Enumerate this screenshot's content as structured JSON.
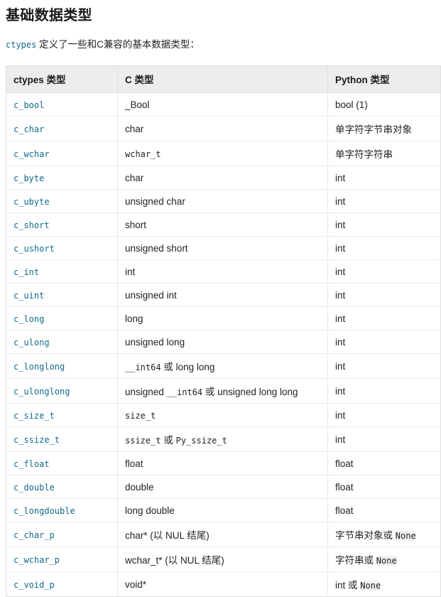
{
  "document": {
    "title": "基础数据类型",
    "intro": {
      "code": "ctypes",
      "text": " 定义了一些和C兼容的基本数据类型："
    }
  },
  "table": {
    "headers": {
      "ctypes": "ctypes 类型",
      "c": "C 类型",
      "python": "Python 类型"
    },
    "rows": [
      {
        "ctypes": "c_bool",
        "c_parts": [
          {
            "t": "_Bool",
            "style": "sans"
          }
        ],
        "py_parts": [
          {
            "t": "bool (1)",
            "style": "sans"
          }
        ]
      },
      {
        "ctypes": "c_char",
        "c_parts": [
          {
            "t": "char",
            "style": "sans"
          }
        ],
        "py_parts": [
          {
            "t": "单字符字节串对象",
            "style": "sans"
          }
        ]
      },
      {
        "ctypes": "c_wchar",
        "c_parts": [
          {
            "t": "wchar_t",
            "style": "mono"
          }
        ],
        "py_parts": [
          {
            "t": "单字符字符串",
            "style": "sans"
          }
        ]
      },
      {
        "ctypes": "c_byte",
        "c_parts": [
          {
            "t": "char",
            "style": "sans"
          }
        ],
        "py_parts": [
          {
            "t": "int",
            "style": "sans"
          }
        ]
      },
      {
        "ctypes": "c_ubyte",
        "c_parts": [
          {
            "t": "unsigned char",
            "style": "sans"
          }
        ],
        "py_parts": [
          {
            "t": "int",
            "style": "sans"
          }
        ]
      },
      {
        "ctypes": "c_short",
        "c_parts": [
          {
            "t": "short",
            "style": "sans"
          }
        ],
        "py_parts": [
          {
            "t": "int",
            "style": "sans"
          }
        ]
      },
      {
        "ctypes": "c_ushort",
        "c_parts": [
          {
            "t": "unsigned short",
            "style": "sans"
          }
        ],
        "py_parts": [
          {
            "t": "int",
            "style": "sans"
          }
        ]
      },
      {
        "ctypes": "c_int",
        "c_parts": [
          {
            "t": "int",
            "style": "sans"
          }
        ],
        "py_parts": [
          {
            "t": "int",
            "style": "sans"
          }
        ]
      },
      {
        "ctypes": "c_uint",
        "c_parts": [
          {
            "t": "unsigned int",
            "style": "sans"
          }
        ],
        "py_parts": [
          {
            "t": "int",
            "style": "sans"
          }
        ]
      },
      {
        "ctypes": "c_long",
        "c_parts": [
          {
            "t": "long",
            "style": "sans"
          }
        ],
        "py_parts": [
          {
            "t": "int",
            "style": "sans"
          }
        ]
      },
      {
        "ctypes": "c_ulong",
        "c_parts": [
          {
            "t": "unsigned long",
            "style": "sans"
          }
        ],
        "py_parts": [
          {
            "t": "int",
            "style": "sans"
          }
        ]
      },
      {
        "ctypes": "c_longlong",
        "c_parts": [
          {
            "t": "__int64",
            "style": "mono"
          },
          {
            "t": " 或 long long",
            "style": "sans"
          }
        ],
        "py_parts": [
          {
            "t": "int",
            "style": "sans"
          }
        ]
      },
      {
        "ctypes": "c_ulonglong",
        "c_parts": [
          {
            "t": "unsigned ",
            "style": "sans"
          },
          {
            "t": "__int64",
            "style": "mono"
          },
          {
            "t": " 或 unsigned long long",
            "style": "sans"
          }
        ],
        "py_parts": [
          {
            "t": "int",
            "style": "sans"
          }
        ]
      },
      {
        "ctypes": "c_size_t",
        "c_parts": [
          {
            "t": "size_t",
            "style": "mono"
          }
        ],
        "py_parts": [
          {
            "t": "int",
            "style": "sans"
          }
        ]
      },
      {
        "ctypes": "c_ssize_t",
        "c_parts": [
          {
            "t": "ssize_t",
            "style": "mono"
          },
          {
            "t": " 或 ",
            "style": "sans"
          },
          {
            "t": "Py_ssize_t",
            "style": "mono"
          }
        ],
        "py_parts": [
          {
            "t": "int",
            "style": "sans"
          }
        ]
      },
      {
        "ctypes": "c_float",
        "c_parts": [
          {
            "t": "float",
            "style": "sans"
          }
        ],
        "py_parts": [
          {
            "t": "float",
            "style": "sans"
          }
        ]
      },
      {
        "ctypes": "c_double",
        "c_parts": [
          {
            "t": "double",
            "style": "sans"
          }
        ],
        "py_parts": [
          {
            "t": "float",
            "style": "sans"
          }
        ]
      },
      {
        "ctypes": "c_longdouble",
        "c_parts": [
          {
            "t": "long double",
            "style": "sans"
          }
        ],
        "py_parts": [
          {
            "t": "float",
            "style": "sans"
          }
        ]
      },
      {
        "ctypes": "c_char_p",
        "c_parts": [
          {
            "t": "char* (以 NUL 结尾)",
            "style": "sans"
          }
        ],
        "py_parts": [
          {
            "t": "字节串对象或 ",
            "style": "sans"
          },
          {
            "t": "None",
            "style": "mono-box"
          }
        ]
      },
      {
        "ctypes": "c_wchar_p",
        "c_parts": [
          {
            "t": "wchar_t* (以 NUL 结尾)",
            "style": "sans"
          }
        ],
        "py_parts": [
          {
            "t": "字符串或 ",
            "style": "sans"
          },
          {
            "t": "None",
            "style": "mono-box"
          }
        ]
      },
      {
        "ctypes": "c_void_p",
        "c_parts": [
          {
            "t": "void*",
            "style": "sans"
          }
        ],
        "py_parts": [
          {
            "t": "int 或 ",
            "style": "sans"
          },
          {
            "t": "None",
            "style": "mono-box"
          }
        ]
      }
    ]
  },
  "colors": {
    "link": "#0f6a8b",
    "header_bg": "#ededed",
    "border": "#e8e8e8",
    "text": "#222222",
    "code_bg": "#efefef"
  }
}
